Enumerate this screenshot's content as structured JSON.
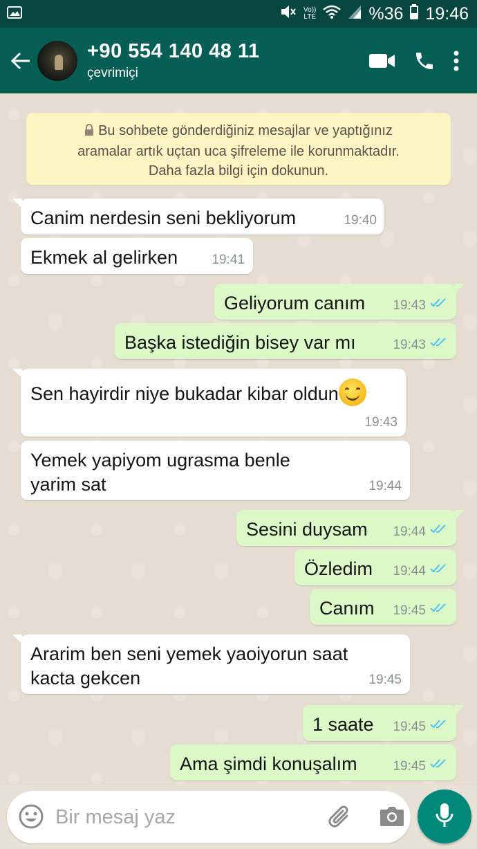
{
  "status_bar": {
    "volte": "Vo))",
    "lte": "LTE",
    "battery": "%36",
    "time": "19:46",
    "icons": [
      "gallery-icon",
      "mute-icon",
      "wifi-icon",
      "signal-icon",
      "battery-icon"
    ]
  },
  "header": {
    "contact_name": "+90 554 140 48 11",
    "status": "çevrimiçi",
    "icons": [
      "back-arrow-icon",
      "video-call-icon",
      "phone-icon",
      "more-vert-icon"
    ]
  },
  "notice": {
    "line1": "Bu sohbete gönderdiğiniz mesajlar ve yaptığınız",
    "line2": "aramalar artık uçtan uca şifreleme ile korunmaktadır.",
    "line3": "Daha fazla bilgi için dokunun."
  },
  "messages": [
    {
      "dir": "in",
      "text": "Canim nerdesin seni bekliyorum",
      "time": "19:40"
    },
    {
      "dir": "in",
      "text": "Ekmek al gelirken",
      "time": "19:41"
    },
    {
      "dir": "out",
      "text": "Geliyorum canım",
      "time": "19:43",
      "status": "read"
    },
    {
      "dir": "out",
      "text": "Başka istediğin bisey var mı",
      "time": "19:43",
      "status": "read"
    },
    {
      "dir": "in",
      "text": "Sen hayirdir niye bukadar kibar oldun",
      "emoji": "smiling-face-icon",
      "time": "19:43"
    },
    {
      "dir": "in",
      "text": "Yemek yapiyom ugrasma benle",
      "text2": "yarim sat",
      "time": "19:44"
    },
    {
      "dir": "out",
      "text": "Sesini duysam",
      "time": "19:44",
      "status": "read"
    },
    {
      "dir": "out",
      "text": "Özledim",
      "time": "19:44",
      "status": "read"
    },
    {
      "dir": "out",
      "text": "Canım",
      "time": "19:45",
      "status": "read"
    },
    {
      "dir": "in",
      "text": "Ararim ben seni yemek yaoiyorun saat",
      "text2": "kacta gekcen",
      "time": "19:45"
    },
    {
      "dir": "out",
      "text": "1 saate",
      "time": "19:45",
      "status": "read"
    },
    {
      "dir": "out",
      "text": "Ama şimdi konuşalım",
      "time": "19:45",
      "status": "read"
    }
  ],
  "composer": {
    "placeholder": "Bir mesaj yaz",
    "icons": [
      "emoji-icon",
      "attach-icon",
      "camera-icon",
      "mic-icon"
    ]
  },
  "colors": {
    "header": "#075e54",
    "status_bar": "#07473f",
    "outgoing_bubble": "#dcf8c6",
    "incoming_bubble": "#ffffff",
    "notice_bg": "#fdf4c4",
    "read_ticks": "#4fc3f7",
    "fab": "#00897b"
  }
}
